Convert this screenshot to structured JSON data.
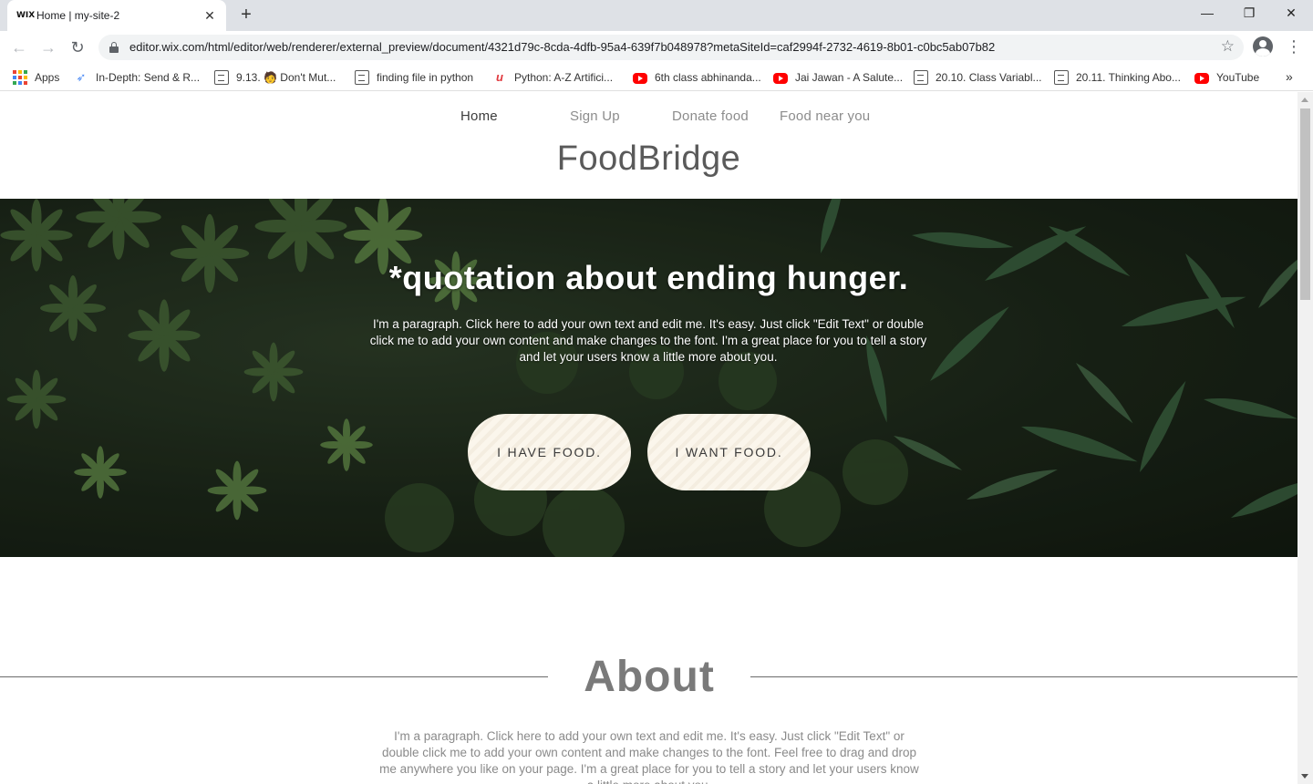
{
  "browser": {
    "tab": {
      "favicon": "WIX",
      "title": "Home | my-site-2",
      "close": "✕"
    },
    "new_tab": "+",
    "window_controls": {
      "minimize": "—",
      "restore": "❐",
      "close": "✕"
    },
    "url": "editor.wix.com/html/editor/web/renderer/external_preview/document/4321d79c-8cda-4dfb-95a4-639f7b048978?metaSiteId=caf2994f-2732-4619-8b01-c0bc5ab07b82",
    "nav": {
      "back": "←",
      "forward": "→",
      "reload": "↻"
    },
    "star": "☆",
    "menu": "⋮",
    "bookmarks": [
      {
        "label": "Apps",
        "icon": "apps-grid-icon"
      },
      {
        "label": "In-Depth: Send & R...",
        "icon": "send-icon"
      },
      {
        "label": "9.13. 🧑 Don't Mut...",
        "icon": "document-icon"
      },
      {
        "label": "finding file in python",
        "icon": "document-icon"
      },
      {
        "label": "Python: A-Z Artifici...",
        "icon": "udemy-icon"
      },
      {
        "label": "6th class abhinanda...",
        "icon": "youtube-icon"
      },
      {
        "label": "Jai Jawan - A Salute...",
        "icon": "youtube-icon"
      },
      {
        "label": "20.10. Class Variabl...",
        "icon": "document-icon"
      },
      {
        "label": "20.11. Thinking Abo...",
        "icon": "document-icon"
      },
      {
        "label": "YouTube",
        "icon": "youtube-icon"
      }
    ],
    "bookmarks_more": "»"
  },
  "site": {
    "nav": [
      {
        "label": "Home",
        "active": true
      },
      {
        "label": "Sign Up",
        "active": false
      },
      {
        "label": "Donate food",
        "active": false
      },
      {
        "label": "Food near you",
        "active": false
      }
    ],
    "brand": "FoodBridge",
    "hero": {
      "quote": "*quotation about ending hunger.",
      "paragraph": "I'm a paragraph. Click here to add your own text and edit me. It's easy. Just click \"Edit Text\" or double click me to add your own content and make changes to the font. I'm a great place for you to tell a story and let your users know a little more about you.",
      "buttons": {
        "have": "I HAVE FOOD.",
        "want": "I WANT FOOD."
      }
    },
    "about": {
      "title": "About",
      "paragraph": "I'm a paragraph. Click here to add your own text and edit me. It's easy. Just click \"Edit Text\" or double click me to add your own content and make changes to the font. Feel free to drag and drop me anywhere you like on your page. I'm a great place for you to tell a story and let your users know a little more about you."
    }
  },
  "colors": {
    "tabstrip": "#dee1e6",
    "pill_bg": "#fbf6ec",
    "hero_dark": "#1c2719",
    "brand_text": "#5a5a5a"
  }
}
